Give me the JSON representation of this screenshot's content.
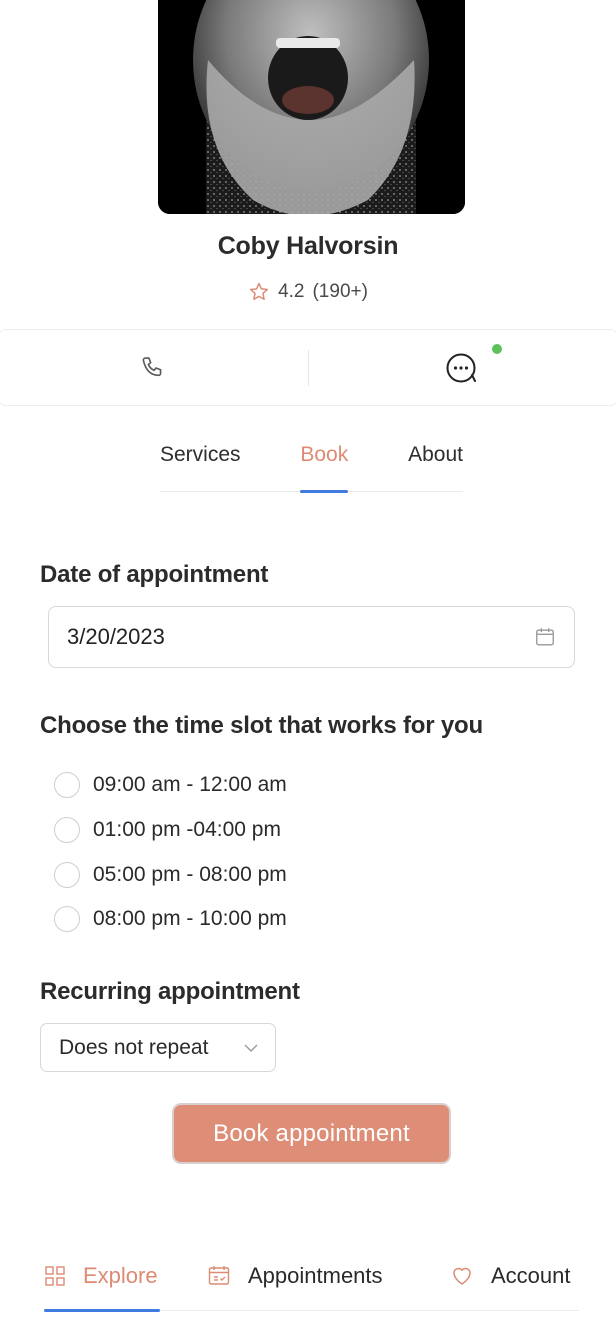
{
  "profile": {
    "name": "Coby Halvorsin",
    "rating_value": "4.2",
    "rating_count": "(190+)",
    "photo_icon": "portrait-photo"
  },
  "contact": {
    "call_icon": "phone-icon",
    "message_icon": "chat-bubble-icon",
    "online": true
  },
  "tabs": [
    {
      "label": "Services",
      "active": false
    },
    {
      "label": "Book",
      "active": true
    },
    {
      "label": "About",
      "active": false
    }
  ],
  "booking": {
    "date_title": "Date of appointment",
    "date_value": "3/20/2023",
    "slot_title": "Choose the time slot that works for you",
    "slots": [
      "09:00 am - 12:00 am",
      "01:00 pm -04:00 pm",
      "05:00 pm - 08:00 pm",
      "08:00 pm - 10:00 pm"
    ],
    "recurring_title": "Recurring appointment",
    "recurring_value": "Does not repeat",
    "button_label": "Book appointment"
  },
  "nav": {
    "explore": "Explore",
    "appointments": "Appointments",
    "account": "Account"
  },
  "colors": {
    "accent": "#dd8a73",
    "button": "#de8e77",
    "indicator": "#3f7be0",
    "online": "#5dc15a"
  }
}
